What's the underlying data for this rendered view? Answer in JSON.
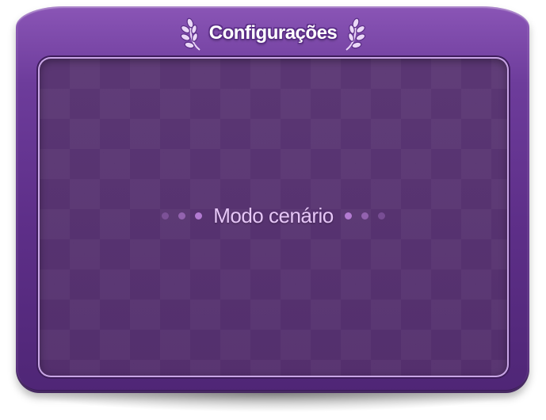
{
  "dialog": {
    "title": "Configurações",
    "mode_label": "Modo cenário"
  },
  "icons": {
    "left_ornament": "laurel-left-icon",
    "right_ornament": "laurel-right-icon"
  },
  "colors": {
    "frame": "#6d3c9b",
    "panel": "#55306f",
    "title_text": "#ffffff",
    "mode_text": "#e6c6f7",
    "dots": "#b77ed6"
  }
}
